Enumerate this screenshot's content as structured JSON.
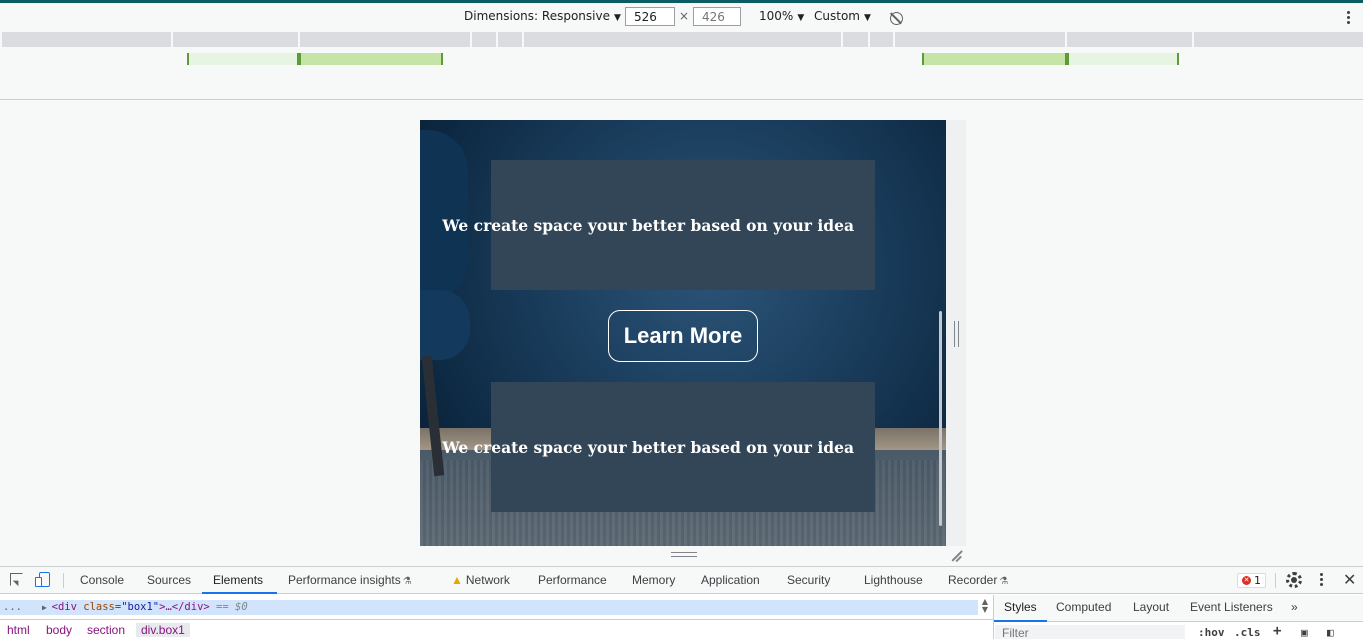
{
  "toolbar": {
    "dimensions_label": "Dimensions: Responsive",
    "width_value": "526",
    "times_sign": "×",
    "height_placeholder": "426",
    "zoom_label": "100%",
    "throttle_label": "Custom"
  },
  "viewport": {
    "box1_text": "We create space your better based on your idea",
    "button_label": "Learn More",
    "box2_text": "We create space your better based on your idea"
  },
  "devtools": {
    "tabs": [
      "Console",
      "Sources",
      "Elements",
      "Performance insights",
      "Network",
      "Performance",
      "Memory",
      "Application",
      "Security",
      "Lighthouse",
      "Recorder"
    ],
    "active_tab": "Elements",
    "error_count": "1",
    "elements_row": {
      "dots": "...",
      "open_tag": "<div",
      "attr_name": "class",
      "attr_value": "\"box1\"",
      "tag_close": ">…</div>",
      "selected_marker": "== $0"
    },
    "breadcrumbs": [
      "html",
      "body",
      "section",
      "div.box1"
    ],
    "styles_tabs": [
      "Styles",
      "Computed",
      "Layout",
      "Event Listeners"
    ],
    "more_tabs": "»",
    "filter_placeholder": "Filter",
    "hov_label": ":hov",
    "cls_label": ".cls",
    "add_label": "+"
  },
  "colors": {
    "accent": "#1a73e8",
    "box_bg": "#334657",
    "media_query_green": "#c5e4a5"
  }
}
